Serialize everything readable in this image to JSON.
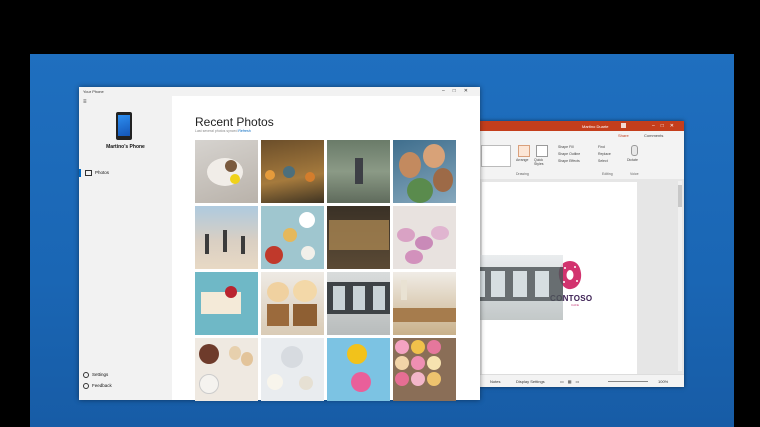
{
  "desktop": {
    "background": "#1a66b4"
  },
  "powerpoint": {
    "title": "Martino Duarte",
    "tabs": {
      "share": "Share",
      "comments": "Comments"
    },
    "ribbon": {
      "arrange": "Arrange",
      "quick_styles": "Quick Styles",
      "shape_fill": "Shape Fill",
      "shape_outline": "Shape Outline",
      "shape_effects": "Shape Effects",
      "find": "Find",
      "replace": "Replace",
      "select": "Select",
      "dictate": "Dictate",
      "group_drawing": "Drawing",
      "group_editing": "Editing",
      "group_voice": "Voice"
    },
    "slide": {
      "logo_text": "CONTOSO",
      "logo_sub": "CAFE"
    },
    "status": {
      "notes": "Notes",
      "display_settings": "Display Settings",
      "zoom": "100%"
    },
    "accent": "#c43e1c"
  },
  "your_phone": {
    "title": "Your Phone",
    "phone_name": "Martino's Phone",
    "nav": {
      "photos": "Photos",
      "settings": "Settings",
      "feedback": "Feedback"
    },
    "heading": "Recent Photos",
    "subtext": "Last several photos synced",
    "subtext_link": "Refresh",
    "accent": "#0067c0"
  }
}
